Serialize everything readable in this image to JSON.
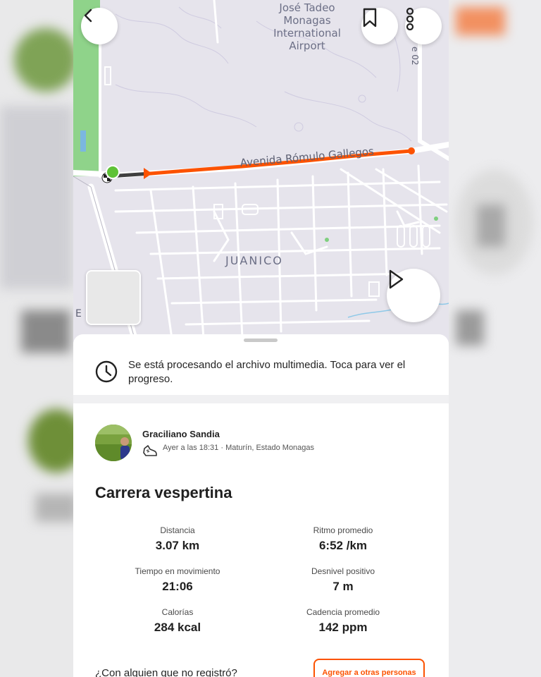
{
  "map": {
    "airport_label_lines": [
      "José Tadeo",
      "Monagas",
      "International",
      "Airport"
    ],
    "street_label": "Avenida Rómulo Gallegos",
    "neighborhood_label": "JUANICO",
    "side_road_label": "e 02",
    "edge_label": "E",
    "colors": {
      "route": "#fc5200",
      "start": "#5ec236",
      "background": "#e6e4ec",
      "roads": "#ffffff"
    }
  },
  "map_controls": {
    "back_icon": "chevron-left-icon",
    "bookmark_icon": "bookmark-icon",
    "more_icon": "more-vertical-icon",
    "play_icon": "play-icon"
  },
  "media_notice": {
    "icon": "clock-icon",
    "text": "Se está procesando el archivo multimedia. Toca para ver el progreso."
  },
  "athlete": {
    "name": "Graciliano Sandia",
    "activity_icon": "shoe-icon",
    "meta": "Ayer a las 18:31 · Maturín, Estado Monagas"
  },
  "activity": {
    "title": "Carrera vespertina",
    "stats": [
      {
        "label": "Distancia",
        "value": "3.07 km"
      },
      {
        "label": "Ritmo promedio",
        "value": "6:52 /km"
      },
      {
        "label": "Tiempo en movimiento",
        "value": "21:06"
      },
      {
        "label": "Desnivel positivo",
        "value": "7 m"
      },
      {
        "label": "Calorías",
        "value": "284 kcal"
      },
      {
        "label": "Cadencia promedio",
        "value": "142 ppm"
      }
    ]
  },
  "tagging": {
    "question": "¿Con alguien que no registró?",
    "button_label": "Agregar a otras personas"
  }
}
